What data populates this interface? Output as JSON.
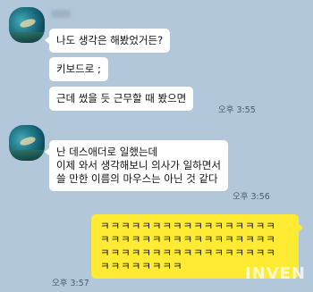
{
  "chat": {
    "group1": {
      "messages": [
        "나도 생각은 해봤었거든?",
        "키보드로 ;",
        "근데 썼을 듯 근무할 때 봤으면"
      ],
      "time": "오후 3:55"
    },
    "group2": {
      "message": "난 데스애더로 일했는데\n이제 와서 생각해보니 의사가 일하면서\n쓸 만한 이름의 마우스는 아닌 것 같다",
      "time": "오후 3:56"
    },
    "group3": {
      "message": "ㅋㅋㅋㅋㅋㅋㅋㅋㅋㅋㅋㅋㅋㅋㅋㅋㅋ\nㅋㅋㅋㅋㅋㅋㅋㅋㅋㅋㅋㅋㅋㅋㅋㅋㅋ\nㅋㅋㅋㅋㅋㅋㅋㅋㅋㅋㅋㅋㅋㅋㅋㅋㅋ\nㅋㅋㅋㅋㅋㅋㅋㅋ",
      "time": "오후 3:57"
    }
  },
  "watermark": "INVEN",
  "colors": {
    "background": "#b2c7d9",
    "incoming_bubble": "#ffffff",
    "outgoing_bubble": "#ffeb33"
  }
}
